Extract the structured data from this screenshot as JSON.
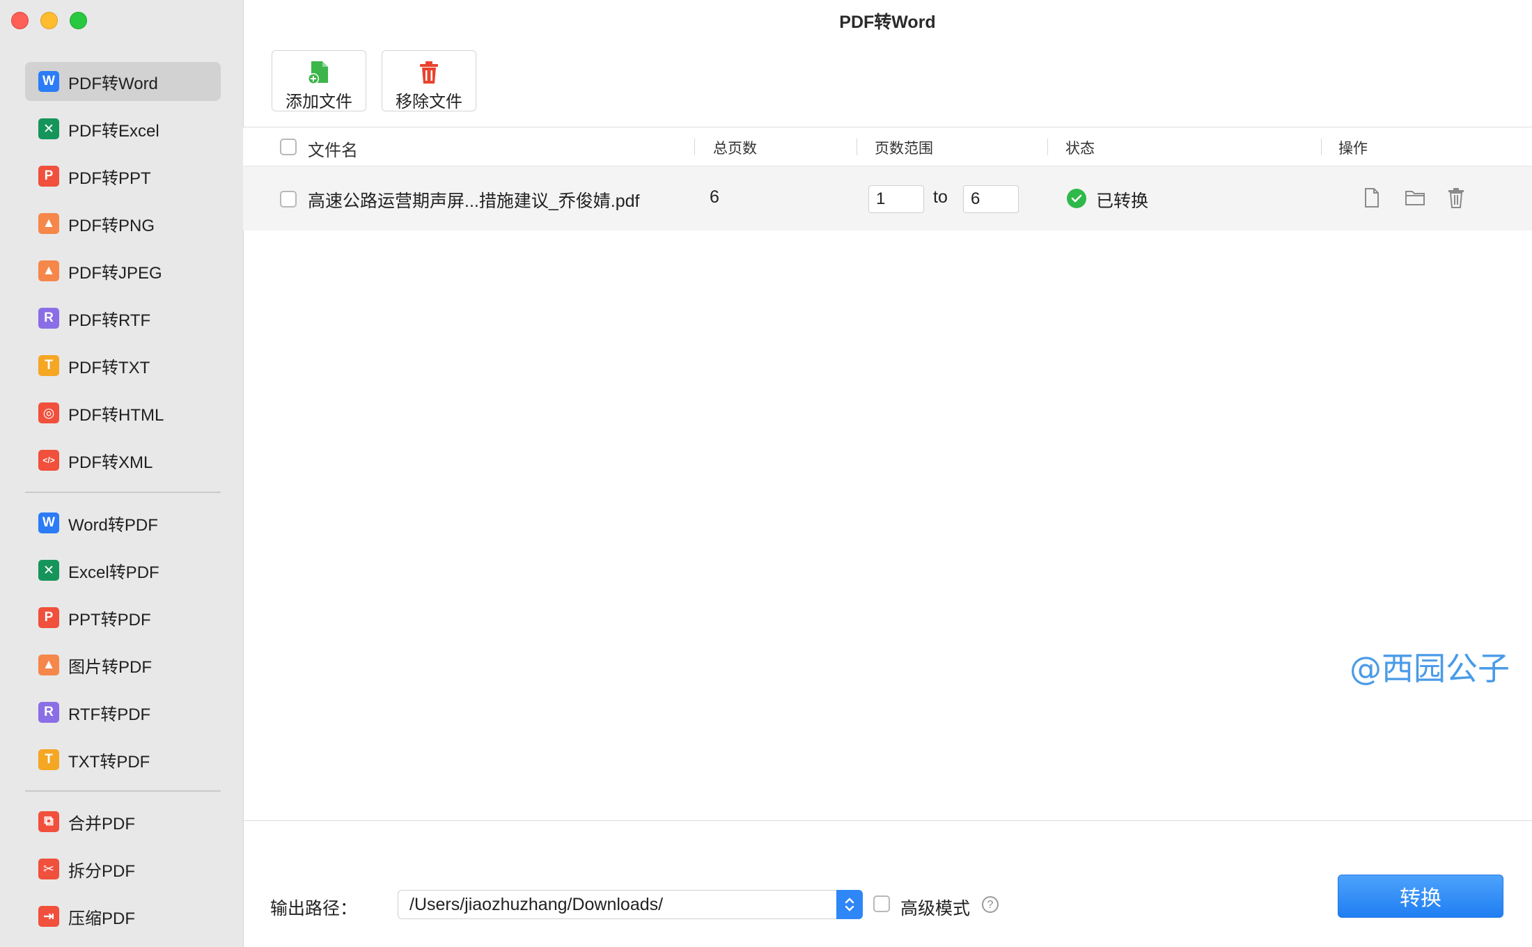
{
  "window": {
    "title": "PDF转Word"
  },
  "colors": {
    "word": "#2b7cf6",
    "excel": "#16955b",
    "ppt": "#f0503c",
    "image": "#f5874a",
    "rtf": "#8a6ee6",
    "txt": "#f5a623",
    "html": "#f0503c",
    "xml": "#f0503c",
    "accent": "#2f86f6",
    "success": "#2fb94a",
    "watermark": "#4a9be8"
  },
  "sidebar": {
    "group1": [
      {
        "label": "PDF转Word",
        "icon": "W",
        "icon_name": "word-icon",
        "color": "word",
        "active": true
      },
      {
        "label": "PDF转Excel",
        "icon": "✕",
        "icon_name": "excel-icon",
        "color": "excel"
      },
      {
        "label": "PDF转PPT",
        "icon": "P",
        "icon_name": "ppt-icon",
        "color": "ppt"
      },
      {
        "label": "PDF转PNG",
        "icon": "▲",
        "icon_name": "image-icon",
        "color": "image"
      },
      {
        "label": "PDF转JPEG",
        "icon": "▲",
        "icon_name": "image-icon",
        "color": "image"
      },
      {
        "label": "PDF转RTF",
        "icon": "R",
        "icon_name": "rtf-icon",
        "color": "rtf"
      },
      {
        "label": "PDF转TXT",
        "icon": "T",
        "icon_name": "txt-icon",
        "color": "txt"
      },
      {
        "label": "PDF转HTML",
        "icon": "◎",
        "icon_name": "globe-icon",
        "color": "html"
      },
      {
        "label": "PDF转XML",
        "icon": "</>",
        "icon_name": "code-icon",
        "color": "xml"
      }
    ],
    "group2": [
      {
        "label": "Word转PDF",
        "icon": "W",
        "icon_name": "word-icon",
        "color": "word"
      },
      {
        "label": "Excel转PDF",
        "icon": "✕",
        "icon_name": "excel-icon",
        "color": "excel"
      },
      {
        "label": "PPT转PDF",
        "icon": "P",
        "icon_name": "ppt-icon",
        "color": "ppt"
      },
      {
        "label": "图片转PDF",
        "icon": "▲",
        "icon_name": "image-icon",
        "color": "image"
      },
      {
        "label": "RTF转PDF",
        "icon": "R",
        "icon_name": "rtf-icon",
        "color": "rtf"
      },
      {
        "label": "TXT转PDF",
        "icon": "T",
        "icon_name": "txt-icon",
        "color": "txt"
      }
    ],
    "group3": [
      {
        "label": "合并PDF",
        "icon": "⧉",
        "icon_name": "merge-icon",
        "color": "ppt"
      },
      {
        "label": "拆分PDF",
        "icon": "✂",
        "icon_name": "scissors-icon",
        "color": "ppt"
      },
      {
        "label": "压缩PDF",
        "icon": "⇥",
        "icon_name": "compress-icon",
        "color": "ppt"
      }
    ]
  },
  "toolbar": {
    "add_label": "添加文件",
    "remove_label": "移除文件"
  },
  "table": {
    "headers": {
      "filename": "文件名",
      "pages": "总页数",
      "range": "页数范围",
      "status": "状态",
      "actions": "操作"
    },
    "rows": [
      {
        "filename": "高速公路运营期声屏...措施建议_乔俊婧.pdf",
        "pages": "6",
        "from": "1",
        "to_label": "to",
        "to": "6",
        "status": "已转换"
      }
    ]
  },
  "watermark": "@西园公子",
  "footer": {
    "output_label": "输出路径：",
    "output_path": "/Users/jiaozhuzhang/Downloads/",
    "advanced_label": "高级模式",
    "help": "?",
    "convert_label": "转换"
  }
}
